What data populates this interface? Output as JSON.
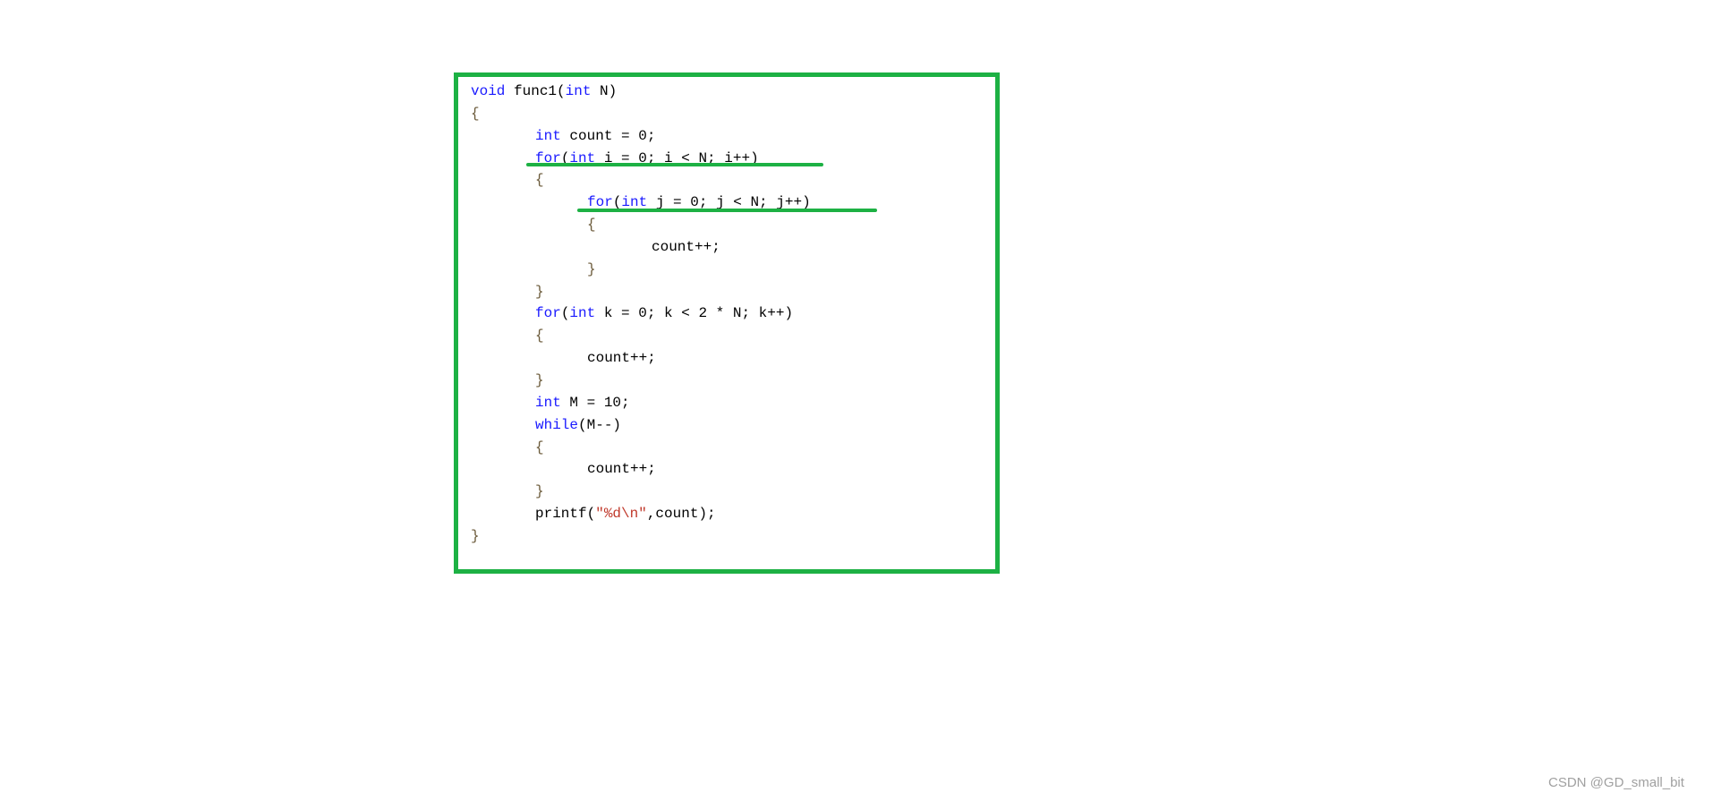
{
  "code": {
    "lines": [
      {
        "indent": 0,
        "tokens": [
          {
            "t": "void",
            "c": "kw"
          },
          {
            "t": " func1(",
            "c": ""
          },
          {
            "t": "int",
            "c": "kw"
          },
          {
            "t": " N)",
            "c": ""
          }
        ]
      },
      {
        "indent": 0,
        "tokens": [
          {
            "t": "{",
            "c": "br"
          }
        ]
      },
      {
        "indent": 1,
        "tokens": [
          {
            "t": "int",
            "c": "kw"
          },
          {
            "t": " count = 0;",
            "c": ""
          }
        ]
      },
      {
        "indent": 1,
        "tokens": [
          {
            "t": "for",
            "c": "kw"
          },
          {
            "t": "(",
            "c": ""
          },
          {
            "t": "int",
            "c": "kw"
          },
          {
            "t": " i = 0; i < N; i++)",
            "c": ""
          }
        ]
      },
      {
        "indent": 1,
        "tokens": [
          {
            "t": "{",
            "c": "br"
          }
        ]
      },
      {
        "indent": 2,
        "tokens": [
          {
            "t": "for",
            "c": "kw"
          },
          {
            "t": "(",
            "c": ""
          },
          {
            "t": "int",
            "c": "kw"
          },
          {
            "t": " j = 0; j < N; j++)",
            "c": ""
          }
        ]
      },
      {
        "indent": 2,
        "tokens": [
          {
            "t": "{",
            "c": "br"
          }
        ]
      },
      {
        "indent": 3,
        "tokens": [
          {
            "t": "count++;",
            "c": ""
          }
        ]
      },
      {
        "indent": 2,
        "tokens": [
          {
            "t": "}",
            "c": "br"
          }
        ]
      },
      {
        "indent": 1,
        "tokens": [
          {
            "t": "}",
            "c": "br"
          }
        ]
      },
      {
        "indent": 1,
        "tokens": [
          {
            "t": "for",
            "c": "kw"
          },
          {
            "t": "(",
            "c": ""
          },
          {
            "t": "int",
            "c": "kw"
          },
          {
            "t": " k = 0; k < 2 * N; k++)",
            "c": ""
          }
        ]
      },
      {
        "indent": 1,
        "tokens": [
          {
            "t": "{",
            "c": "br"
          }
        ]
      },
      {
        "indent": 2,
        "tokens": [
          {
            "t": "count++;",
            "c": ""
          }
        ]
      },
      {
        "indent": 1,
        "tokens": [
          {
            "t": "}",
            "c": "br"
          }
        ]
      },
      {
        "indent": 1,
        "tokens": [
          {
            "t": "int",
            "c": "kw"
          },
          {
            "t": " M = 10;",
            "c": ""
          }
        ]
      },
      {
        "indent": 1,
        "tokens": [
          {
            "t": "while",
            "c": "kw"
          },
          {
            "t": "(M--)",
            "c": ""
          }
        ]
      },
      {
        "indent": 1,
        "tokens": [
          {
            "t": "{",
            "c": "br"
          }
        ]
      },
      {
        "indent": 2,
        "tokens": [
          {
            "t": "count++;",
            "c": ""
          }
        ]
      },
      {
        "indent": 1,
        "tokens": [
          {
            "t": "}",
            "c": "br"
          }
        ]
      },
      {
        "indent": 1,
        "tokens": [
          {
            "t": "printf(",
            "c": ""
          },
          {
            "t": "\"%d\\n\"",
            "c": "str"
          },
          {
            "t": ",count);",
            "c": ""
          }
        ]
      },
      {
        "indent": 0,
        "tokens": [
          {
            "t": "}",
            "c": "br"
          }
        ]
      }
    ]
  },
  "colors": {
    "highlight_box": "#1db144",
    "keyword": "#1a1aff",
    "string": "#c0392b"
  },
  "watermark": "CSDN @GD_small_bit"
}
